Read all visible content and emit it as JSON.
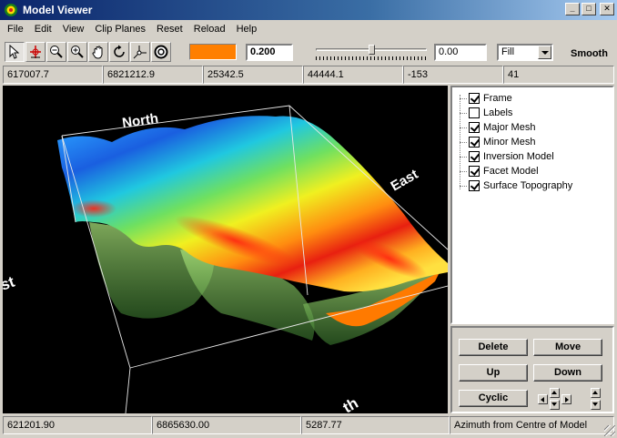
{
  "window": {
    "title": "Model Viewer"
  },
  "menu": [
    "File",
    "Edit",
    "View",
    "Clip Planes",
    "Reset",
    "Reload",
    "Help"
  ],
  "toolbar": {
    "tools": [
      "select-icon",
      "pick-point-icon",
      "zoom-out-icon",
      "zoom-in-icon",
      "pan-hand-icon",
      "rotate-icon",
      "axes-icon",
      "sphere-icon"
    ],
    "color": "#ff7f00",
    "opacity_value": "0.200",
    "slider_level": 0.5,
    "slider_value": "0.00",
    "render_mode": "Fill",
    "smooth_label": "Smooth"
  },
  "coords": [
    "617007.7",
    "6821212.9",
    "25342.5",
    "44444.1",
    "-153",
    "41"
  ],
  "viewport": {
    "labels": {
      "north": "North",
      "east": "East",
      "west_partial": "st",
      "south_partial": "th"
    }
  },
  "layers": [
    {
      "label": "Frame",
      "checked": true
    },
    {
      "label": "Labels",
      "checked": false
    },
    {
      "label": "Major Mesh",
      "checked": true
    },
    {
      "label": "Minor Mesh",
      "checked": true
    },
    {
      "label": "Inversion Model",
      "checked": true
    },
    {
      "label": "Facet Model",
      "checked": true
    },
    {
      "label": "Surface Topography",
      "checked": true
    }
  ],
  "actions": {
    "delete": "Delete",
    "move": "Move",
    "up": "Up",
    "down": "Down",
    "cyclic": "Cyclic"
  },
  "status": [
    "621201.90",
    "6865630.00",
    "5287.77",
    "Azimuth from Centre of Model"
  ]
}
